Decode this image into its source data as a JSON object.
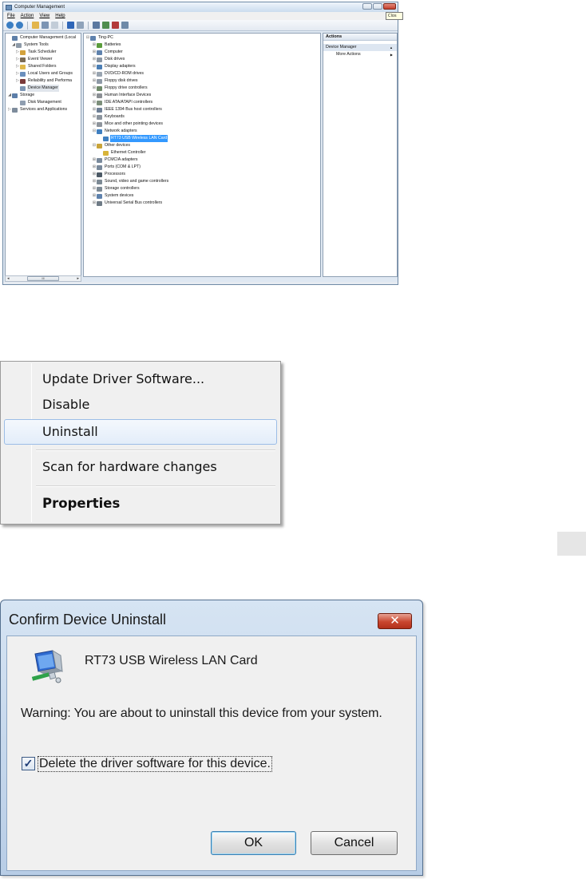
{
  "computer_management": {
    "title": "Computer Management",
    "close_tooltip": "Clos",
    "menu": [
      "File",
      "Action",
      "View",
      "Help"
    ],
    "left_tree": [
      {
        "label": "Computer Management (Local",
        "level": 0,
        "exp": "",
        "icon": "computer-management-icon",
        "color": "#5d7fa8"
      },
      {
        "label": "System Tools",
        "level": 1,
        "exp": "◢",
        "icon": "system-tools-icon",
        "color": "#8d9aa8"
      },
      {
        "label": "Task Scheduler",
        "level": 2,
        "exp": "▷",
        "icon": "task-scheduler-icon",
        "color": "#d3a23c"
      },
      {
        "label": "Event Viewer",
        "level": 2,
        "exp": "▷",
        "icon": "event-viewer-icon",
        "color": "#7b6c55"
      },
      {
        "label": "Shared Folders",
        "level": 2,
        "exp": "▷",
        "icon": "shared-folders-icon",
        "color": "#e0b84a"
      },
      {
        "label": "Local Users and Groups",
        "level": 2,
        "exp": "▷",
        "icon": "users-icon",
        "color": "#6a8fbd"
      },
      {
        "label": "Reliability and Performa",
        "level": 2,
        "exp": "▷",
        "icon": "reliability-icon",
        "color": "#7a3a3a"
      },
      {
        "label": "Device Manager",
        "level": 2,
        "exp": "",
        "icon": "device-manager-icon",
        "color": "#7c95b3",
        "dim": true
      },
      {
        "label": "Storage",
        "level": 0,
        "exp": "◢",
        "icon": "storage-icon",
        "color": "#5c7ea8"
      },
      {
        "label": "Disk Management",
        "level": 2,
        "exp": "",
        "icon": "disk-management-icon",
        "color": "#8f9eb0"
      },
      {
        "label": "Services and Applications",
        "level": 0,
        "exp": "▷",
        "icon": "services-icon",
        "color": "#7e8c9c"
      }
    ],
    "device_tree": [
      {
        "label": "Ting-PC",
        "level": 0,
        "exp": "⊟",
        "icon": "computer-icon",
        "color": "#5f82ad"
      },
      {
        "label": "Batteries",
        "level": 1,
        "exp": "⊞",
        "icon": "battery-icon",
        "color": "#5a9c3c"
      },
      {
        "label": "Computer",
        "level": 1,
        "exp": "⊞",
        "icon": "computer-icon",
        "color": "#5f82ad"
      },
      {
        "label": "Disk drives",
        "level": 1,
        "exp": "⊞",
        "icon": "disk-drive-icon",
        "color": "#8a96a3"
      },
      {
        "label": "Display adapters",
        "level": 1,
        "exp": "⊞",
        "icon": "display-adapter-icon",
        "color": "#4c7fb5"
      },
      {
        "label": "DVD/CD-ROM drives",
        "level": 1,
        "exp": "⊞",
        "icon": "dvd-icon",
        "color": "#9aa5b1"
      },
      {
        "label": "Floppy disk drives",
        "level": 1,
        "exp": "⊞",
        "icon": "floppy-icon",
        "color": "#8e99a6"
      },
      {
        "label": "Floppy drive controllers",
        "level": 1,
        "exp": "⊞",
        "icon": "controller-icon",
        "color": "#6f8a6a"
      },
      {
        "label": "Human Interface Devices",
        "level": 1,
        "exp": "⊞",
        "icon": "hid-icon",
        "color": "#8b8f94"
      },
      {
        "label": "IDE ATA/ATAPI controllers",
        "level": 1,
        "exp": "⊞",
        "icon": "ide-controller-icon",
        "color": "#7d8f7b"
      },
      {
        "label": "IEEE 1394 Bus host controllers",
        "level": 1,
        "exp": "⊞",
        "icon": "ieee1394-icon",
        "color": "#6e7f95"
      },
      {
        "label": "Keyboards",
        "level": 1,
        "exp": "⊞",
        "icon": "keyboard-icon",
        "color": "#8b949e"
      },
      {
        "label": "Mice and other pointing devices",
        "level": 1,
        "exp": "⊞",
        "icon": "mouse-icon",
        "color": "#8f959c"
      },
      {
        "label": "Network adapters",
        "level": 1,
        "exp": "⊟",
        "icon": "network-adapter-icon",
        "color": "#3f7fc0"
      },
      {
        "label": "RT73 USB Wireless LAN Card",
        "level": 2,
        "exp": "",
        "icon": "network-card-icon",
        "color": "#3f7fc0",
        "selected": true
      },
      {
        "label": "Other devices",
        "level": 1,
        "exp": "⊟",
        "icon": "other-devices-icon",
        "color": "#c9a43a"
      },
      {
        "label": "Ethernet Controller",
        "level": 2,
        "exp": "",
        "icon": "unknown-device-icon",
        "color": "#d8b43a"
      },
      {
        "label": "PCMCIA adapters",
        "level": 1,
        "exp": "⊞",
        "icon": "pcmcia-icon",
        "color": "#7a8a9c"
      },
      {
        "label": "Ports (COM & LPT)",
        "level": 1,
        "exp": "⊞",
        "icon": "ports-icon",
        "color": "#7a8a9c"
      },
      {
        "label": "Processors",
        "level": 1,
        "exp": "⊞",
        "icon": "processor-icon",
        "color": "#4d5a66"
      },
      {
        "label": "Sound, video and game controllers",
        "level": 1,
        "exp": "⊞",
        "icon": "sound-icon",
        "color": "#7d8a94"
      },
      {
        "label": "Storage controllers",
        "level": 1,
        "exp": "⊞",
        "icon": "storage-controller-icon",
        "color": "#7d8a94"
      },
      {
        "label": "System devices",
        "level": 1,
        "exp": "⊞",
        "icon": "system-devices-icon",
        "color": "#5f82ad"
      },
      {
        "label": "Universal Serial Bus controllers",
        "level": 1,
        "exp": "⊞",
        "icon": "usb-icon",
        "color": "#6f7b86"
      }
    ],
    "actions": {
      "header": "Actions",
      "section": "Device Manager",
      "section_arrow": "▲",
      "more": "More Actions",
      "more_arrow": "▶"
    },
    "scroll_glyphs": {
      "left": "◂",
      "thumb": "III",
      "right": "▸"
    }
  },
  "context_menu": {
    "items": [
      {
        "label": "Update Driver Software..."
      },
      {
        "label": "Disable"
      },
      {
        "label": "Uninstall",
        "highlight": true
      },
      {
        "label": "Scan for hardware changes"
      },
      {
        "label": "Properties",
        "bold": true
      }
    ]
  },
  "dialog": {
    "title": "Confirm Device Uninstall",
    "close_glyph": "✕",
    "device_name": "RT73 USB Wireless LAN Card",
    "warning": "Warning: You are about to uninstall this device from your system.",
    "checkbox_label": "Delete the driver software for this device.",
    "checkbox_checked": true,
    "checkbox_glyph": "✓",
    "ok_label": "OK",
    "cancel_label": "Cancel"
  }
}
